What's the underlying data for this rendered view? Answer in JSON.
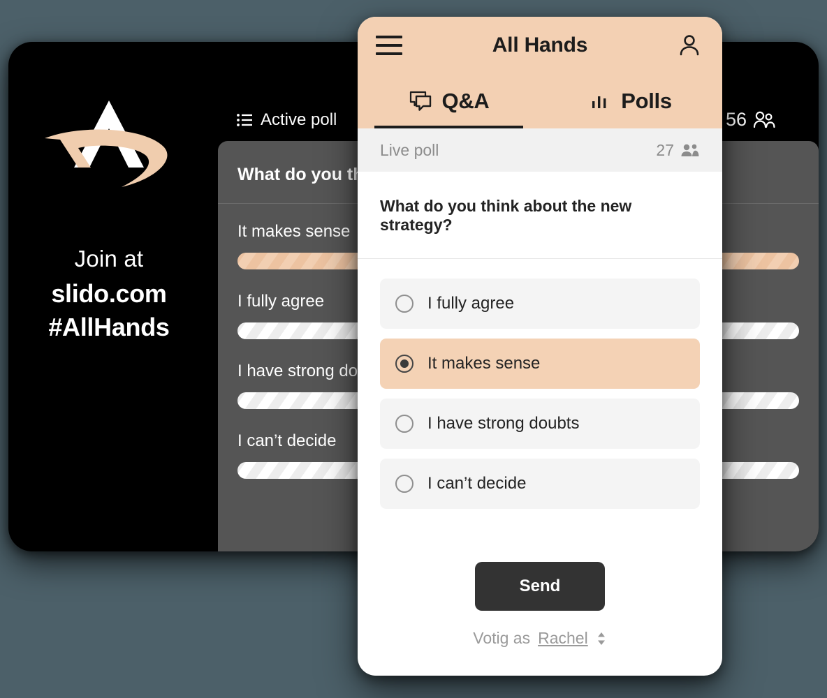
{
  "colors": {
    "page_background": "#4c6069",
    "accent_peach": "#f3d0b3",
    "panel_black": "#000000",
    "results_card": "#555555",
    "send_button": "#333333",
    "option_background": "#f4f4f4",
    "livepoll_bar": "#f1f1f1"
  },
  "presentation": {
    "brand": {
      "logo_name": "slido-logo",
      "join_at": "Join at",
      "url": "slido.com",
      "hashtag": "#AllHands"
    },
    "active_poll_label": "Active poll",
    "active_poll_icon": "list-icon",
    "participants": {
      "count": "56",
      "icon": "people-icon"
    },
    "results": {
      "question": "What do you think about the new strategy?",
      "items": [
        {
          "label": "It makes sense",
          "bar_style": "peach"
        },
        {
          "label": "I fully agree",
          "bar_style": "white"
        },
        {
          "label": "I have strong doubts",
          "bar_style": "white"
        },
        {
          "label": "I can’t decide",
          "bar_style": "white"
        }
      ]
    }
  },
  "mobile": {
    "header": {
      "menu_icon": "hamburger-icon",
      "title": "All Hands",
      "profile_icon": "person-icon"
    },
    "tabs": [
      {
        "label": "Q&A",
        "icon": "chat-bubbles-icon",
        "active": true
      },
      {
        "label": "Polls",
        "icon": "bar-chart-icon",
        "active": false
      }
    ],
    "live_poll": {
      "label": "Live poll",
      "count": "27",
      "icon": "people-icon"
    },
    "poll": {
      "question": "What do you think about the new strategy?",
      "options": [
        {
          "label": "I fully agree",
          "selected": false
        },
        {
          "label": "It makes sense",
          "selected": true
        },
        {
          "label": "I have strong doubts",
          "selected": false
        },
        {
          "label": "I can’t decide",
          "selected": false
        }
      ]
    },
    "send_label": "Send",
    "voting_as_prefix": "Votig as",
    "voting_as_name": "Rachel",
    "voting_as_icon": "sort-chevrons-icon"
  },
  "chart_data": {
    "type": "bar",
    "title": "What do you think about the new strategy?",
    "categories": [
      "It makes sense",
      "I fully agree",
      "I have strong doubts",
      "I can’t decide"
    ],
    "values": [
      100,
      100,
      100,
      100
    ],
    "xlabel": "",
    "ylabel": "",
    "legend": []
  }
}
